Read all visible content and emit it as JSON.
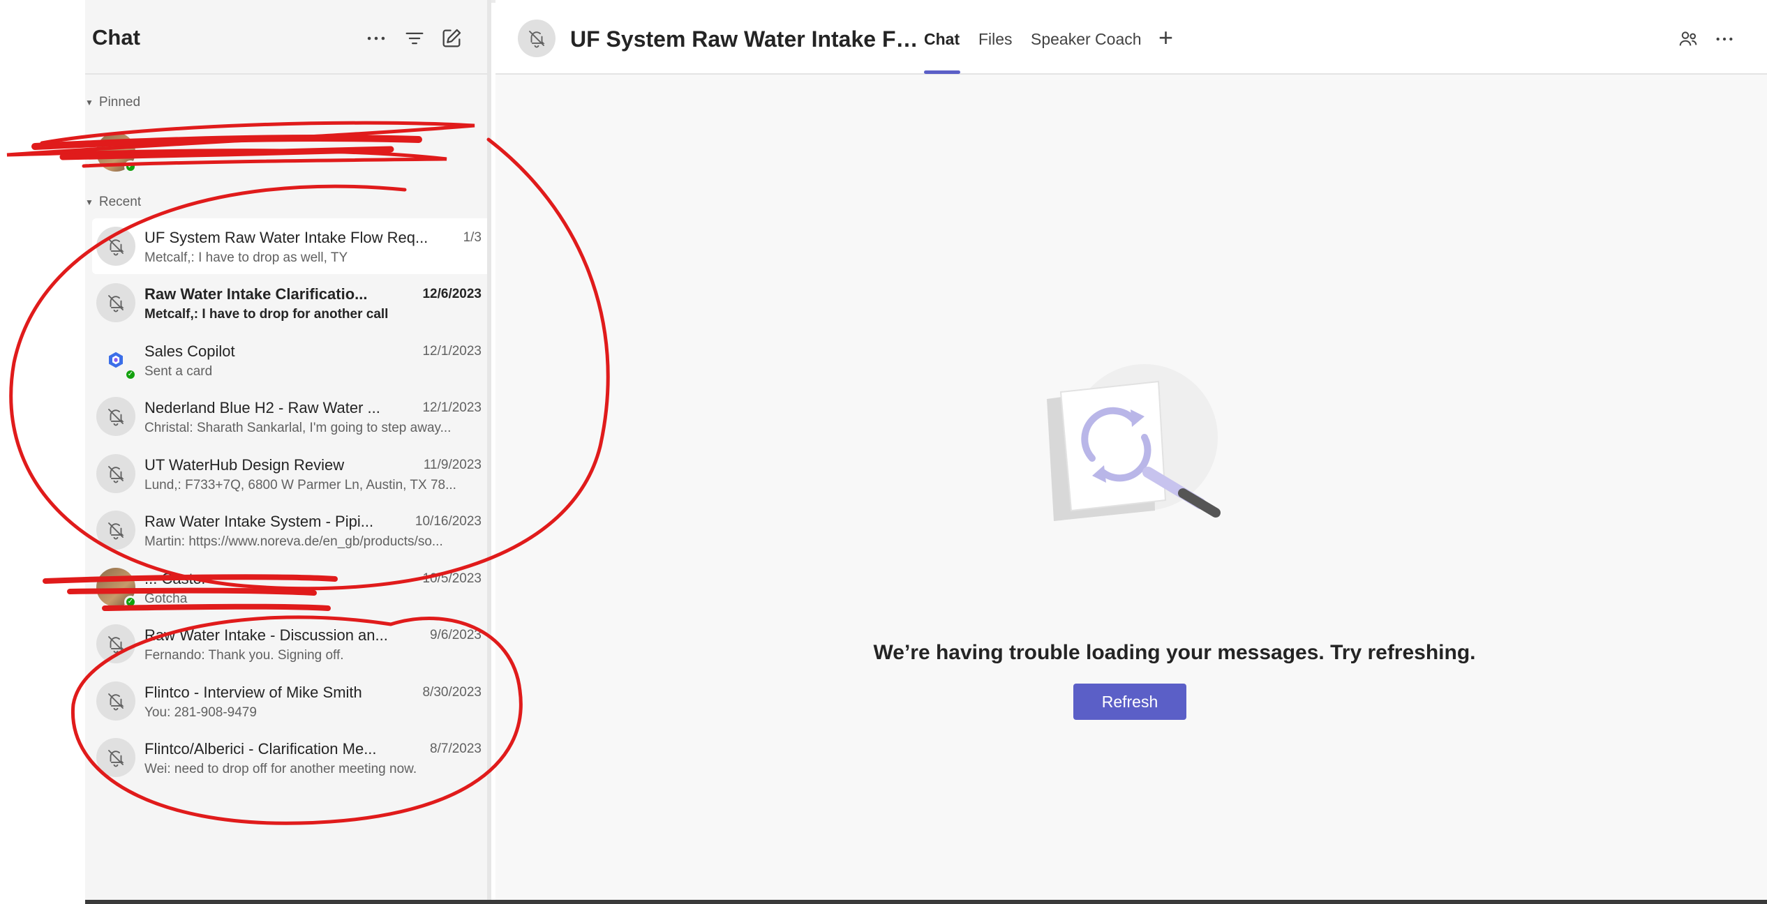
{
  "sidebar": {
    "title": "Chat",
    "header_icons": [
      "more-icon",
      "filter-icon",
      "compose-icon"
    ],
    "pinned_label": "Pinned",
    "recent_label": "Recent",
    "items": [
      {
        "title": "UF System Raw Water Intake Flow Req...",
        "date": "1/3",
        "preview": "Metcalf,: I have to drop as well, TY",
        "avatar": "muted-bell-icon",
        "active": true,
        "bold": false
      },
      {
        "title": "Raw Water Intake Clarificatio...",
        "date": "12/6/2023",
        "preview": "Metcalf,: I have to drop for another call",
        "avatar": "muted-bell-icon",
        "active": false,
        "bold": true
      },
      {
        "title": "Sales Copilot",
        "date": "12/1/2023",
        "preview": "Sent a card",
        "avatar": "copilot-icon",
        "active": false,
        "bold": false
      },
      {
        "title": "Nederland Blue H2 - Raw Water ...",
        "date": "12/1/2023",
        "preview": "Christal: Sharath Sankarlal, I'm going to step away...",
        "avatar": "muted-bell-icon",
        "active": false,
        "bold": false
      },
      {
        "title": "UT WaterHub Design Review",
        "date": "11/9/2023",
        "preview": "Lund,: F733+7Q, 6800 W Parmer Ln, Austin, TX 78...",
        "avatar": "muted-bell-icon",
        "active": false,
        "bold": false
      },
      {
        "title": "Raw Water Intake System - Pipi...",
        "date": "10/16/2023",
        "preview": "Martin: https://www.noreva.de/en_gb/products/so...",
        "avatar": "muted-bell-icon",
        "active": false,
        "bold": false
      },
      {
        "title": "... Castor",
        "date": "10/5/2023",
        "preview": "Gotcha",
        "avatar": "photo",
        "active": false,
        "bold": false
      },
      {
        "title": "Raw Water Intake - Discussion an...",
        "date": "9/6/2023",
        "preview": "Fernando: Thank you.  Signing off.",
        "avatar": "muted-bell-icon",
        "active": false,
        "bold": false
      },
      {
        "title": "Flintco - Interview of Mike Smith",
        "date": "8/30/2023",
        "preview": "You: 281-908-9479",
        "avatar": "muted-bell-icon",
        "active": false,
        "bold": false
      },
      {
        "title": "Flintco/Alberici - Clarification Me...",
        "date": "8/7/2023",
        "preview": "Wei: need to drop off for another meeting now.",
        "avatar": "muted-bell-icon",
        "active": false,
        "bold": false
      }
    ]
  },
  "conversation": {
    "title": "UF System Raw Water Intake Flo...",
    "tabs": [
      {
        "label": "Chat",
        "active": true
      },
      {
        "label": "Files",
        "active": false
      },
      {
        "label": "Speaker Coach",
        "active": false
      }
    ],
    "add_tab": "+",
    "right_icons": [
      "participants-icon",
      "more-icon"
    ]
  },
  "error": {
    "message": "We’re having trouble loading your messages. Try refreshing.",
    "button_label": "Refresh"
  },
  "colors": {
    "accent": "#5b5fc7",
    "sidebar_bg": "#f5f5f5",
    "annotation_red": "#e01b1b",
    "presence_green": "#13a10e"
  }
}
